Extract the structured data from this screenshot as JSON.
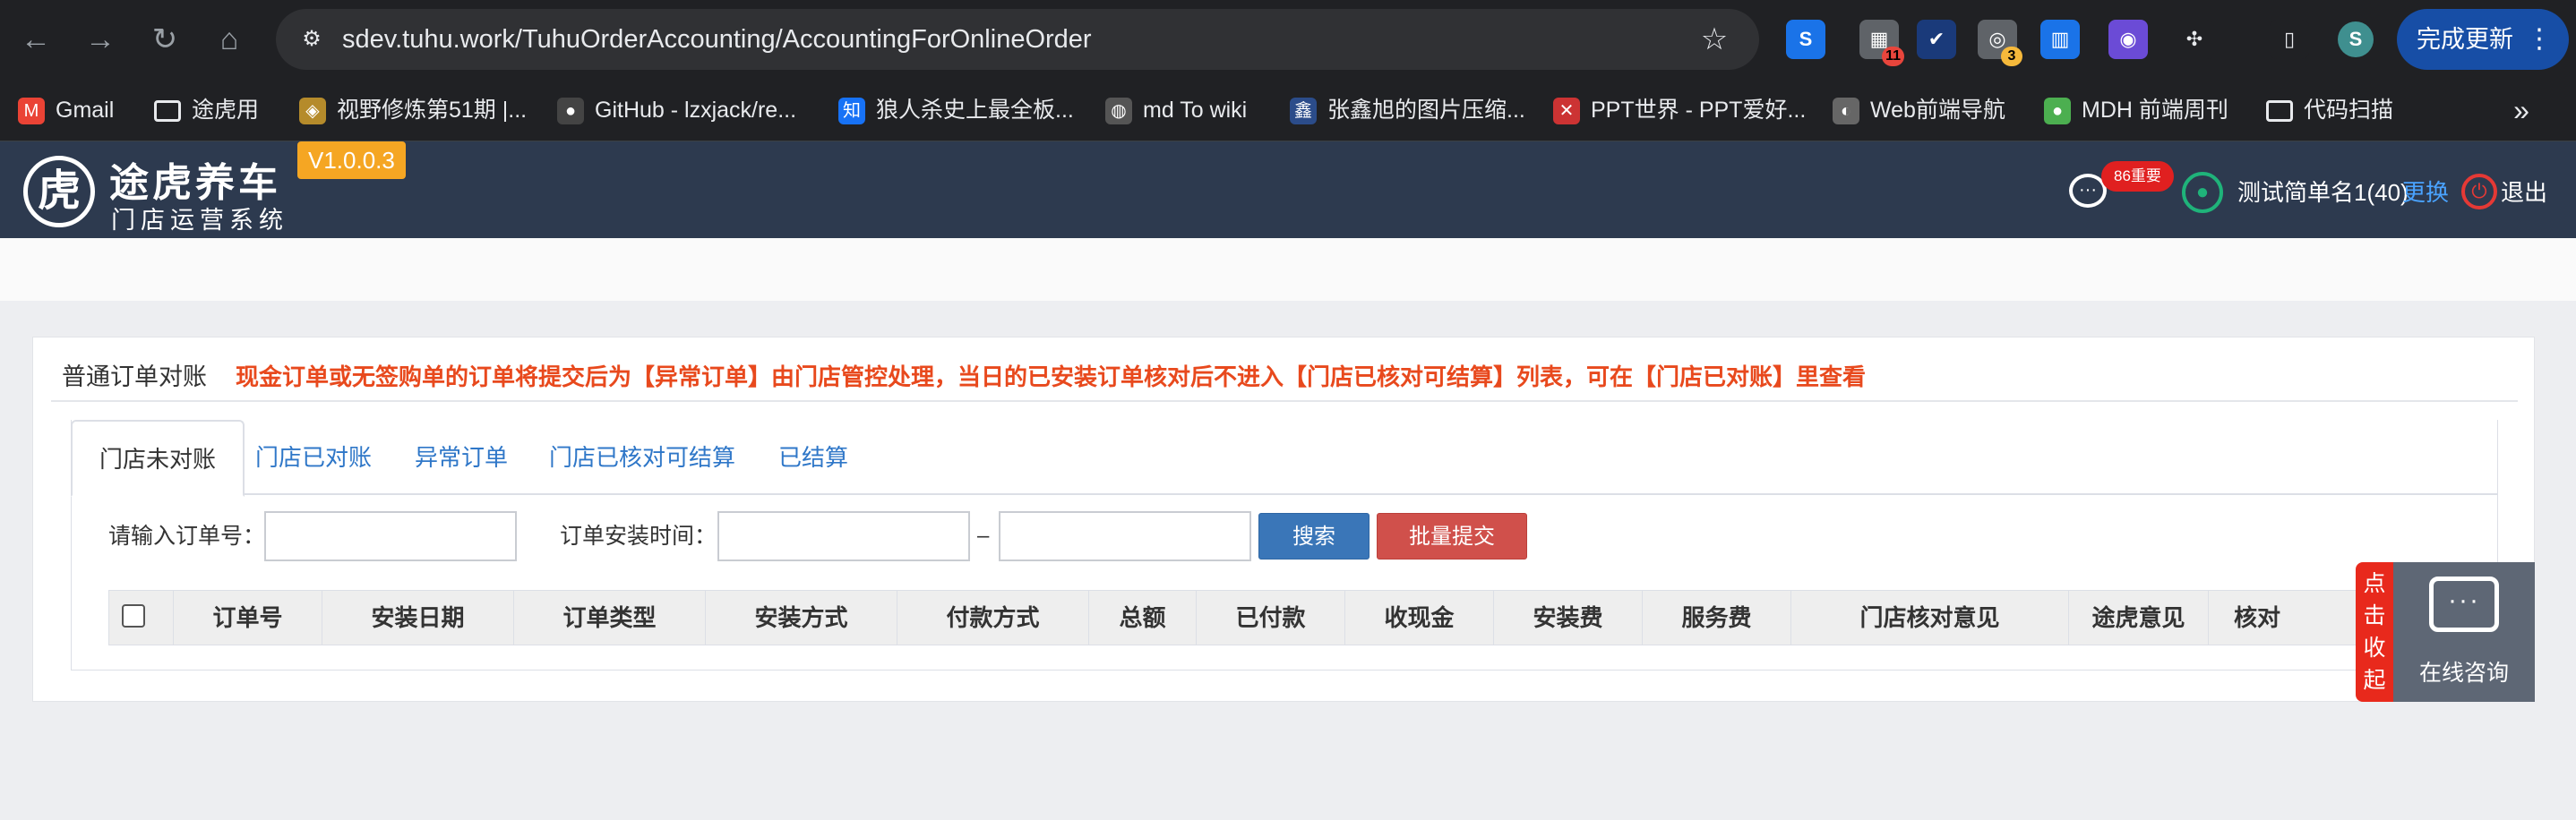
{
  "browser": {
    "url": "sdev.tuhu.work/TuhuOrderAccounting/AccountingForOnlineOrder",
    "update_button": "完成更新",
    "extensions": [
      {
        "name": "s-ext-icon",
        "glyph": "S",
        "color": "#1a73e8"
      },
      {
        "name": "grid-ext-icon",
        "glyph": "▦",
        "color": "#5f6368",
        "badge": "11"
      },
      {
        "name": "check-ext-icon",
        "glyph": "✔",
        "color": "#1a3a7a"
      },
      {
        "name": "circle-ext-icon",
        "glyph": "◎",
        "color": "#5f6368",
        "badge": "3"
      },
      {
        "name": "layout-ext-icon",
        "glyph": "▥",
        "color": "#1a73e8"
      },
      {
        "name": "robot-ext-icon",
        "glyph": "◉",
        "color": "#6b4bd6"
      },
      {
        "name": "puzzle-ext-icon",
        "glyph": "✣",
        "color": "#202124"
      },
      {
        "name": "sidepanel-icon",
        "glyph": "▯",
        "color": "#202124"
      },
      {
        "name": "profile-avatar",
        "glyph": "S",
        "color": "#3f8f8f"
      }
    ]
  },
  "bookmarks": [
    {
      "label": "Gmail",
      "icon": "gmail-icon",
      "glyph": "M",
      "color": "#ea4335"
    },
    {
      "label": "途虎用",
      "icon": "folder-icon",
      "glyph": "▭",
      "color": "transparent"
    },
    {
      "label": "视野修炼第51期 |...",
      "icon": "bookmark-favicon",
      "glyph": "◈",
      "color": "#b58b2b"
    },
    {
      "label": "GitHub - lzxjack/re...",
      "icon": "github-icon",
      "glyph": "●",
      "color": "#444"
    },
    {
      "label": "狼人杀史上最全板...",
      "icon": "zhihu-icon",
      "glyph": "知",
      "color": "#1772f6"
    },
    {
      "label": "md To wiki",
      "icon": "globe-icon",
      "glyph": "◍",
      "color": "#555"
    },
    {
      "label": "张鑫旭的图片压缩...",
      "icon": "xin-icon",
      "glyph": "鑫",
      "color": "#2b4c8a"
    },
    {
      "label": "PPT世界 - PPT爱好...",
      "icon": "ppt-icon",
      "glyph": "✕",
      "color": "#c33"
    },
    {
      "label": "Web前端导航",
      "icon": "penguin-icon",
      "glyph": "◐",
      "color": "#666"
    },
    {
      "label": "MDH 前端周刊",
      "icon": "mdh-icon",
      "glyph": "●",
      "color": "#4caf50"
    },
    {
      "label": "代码扫描",
      "icon": "folder-icon",
      "glyph": "▭",
      "color": "transparent"
    }
  ],
  "app": {
    "brand_name": "途虎养车",
    "brand_sub": "门店运营系统",
    "version": "V1.0.0.3",
    "message_badge": "86重要",
    "user_name": "测试简单名1(40)",
    "switch_label": "更换",
    "logout_label": "退出"
  },
  "card": {
    "title": "普通订单对账",
    "notice": "现金订单或无签购单的订单将提交后为【异常订单】由门店管控处理，当日的已安装订单核对后不进入【门店已核对可结算】列表，可在【门店已对账】里查看",
    "tabs": [
      "门店未对账",
      "门店已对账",
      "异常订单",
      "门店已核对可结算",
      "已结算"
    ],
    "active_tab": 0
  },
  "filters": {
    "order_label": "请输入订单号：",
    "order_value": "",
    "time_label": "订单安装时间：",
    "time_from": "",
    "time_to": "",
    "dash": "–",
    "search_button": "搜索",
    "batch_button": "批量提交"
  },
  "table": {
    "columns": [
      "订单号",
      "安装日期",
      "订单类型",
      "安装方式",
      "付款方式",
      "总额",
      "已付款",
      "收现金",
      "安装费",
      "服务费",
      "门店核对意见",
      "途虎意见",
      "核对"
    ]
  },
  "float_widget": {
    "collapse_label": "点击收起",
    "chat_label": "在线咨询"
  }
}
